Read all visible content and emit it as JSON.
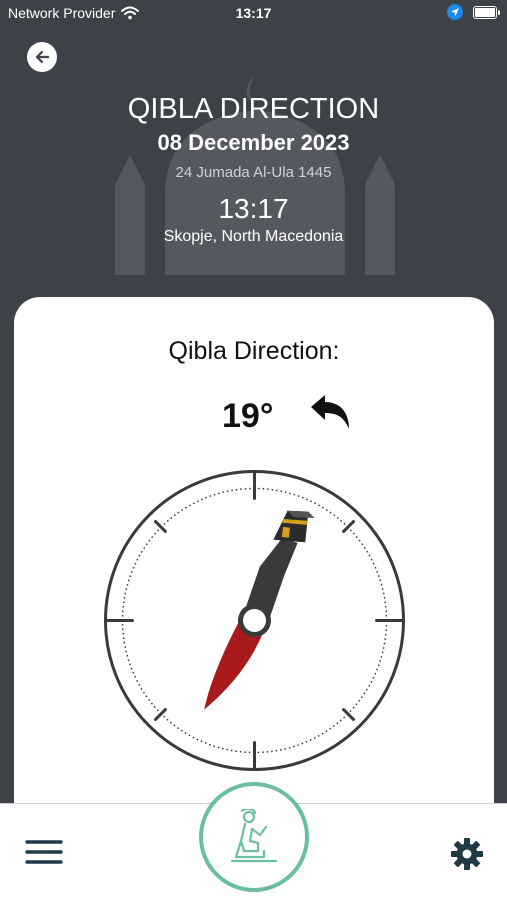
{
  "status_bar": {
    "carrier": "Network Provider",
    "time": "13:17"
  },
  "header": {
    "title": "QIBLA DIRECTION",
    "gregorian_date": "08 December 2023",
    "hijri_date": "24 Jumada Al-Ula 1445",
    "time": "13:17",
    "location": "Skopje, North Macedonia"
  },
  "qibla": {
    "label": "Qibla Direction:",
    "degrees": "19°",
    "needle_angle_deg": 19
  },
  "colors": {
    "header_bg": "#3d4249",
    "accent_green": "#6cbf9e",
    "needle_red": "#a91b1b",
    "needle_gray": "#3a3a3a"
  },
  "icons": {
    "back": "arrow-left-icon",
    "turn": "turn-left-arrow-icon",
    "menu": "hamburger-menu-icon",
    "prayer": "praying-person-icon",
    "settings": "gear-icon"
  }
}
